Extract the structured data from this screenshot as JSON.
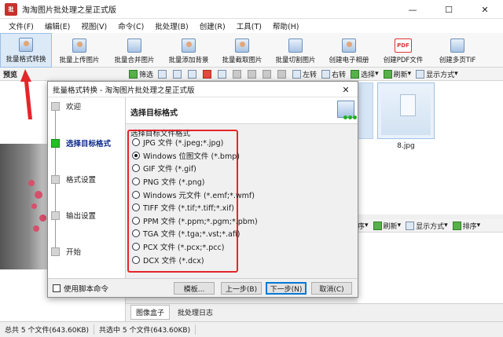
{
  "app": {
    "icon_text": "批",
    "title": "淘淘图片批处理之星正式版"
  },
  "window_controls": {
    "minimize": "—",
    "maximize": "☐",
    "close": "✕"
  },
  "menu": [
    "文件(F)",
    "编辑(E)",
    "视图(V)",
    "命令(C)",
    "批处理(B)",
    "创建(R)",
    "工具(T)",
    "帮助(H)"
  ],
  "toolbar": [
    {
      "label": "批量格式转换",
      "icon": "format-convert-icon"
    },
    {
      "label": "批量上传图片",
      "icon": "upload-icon"
    },
    {
      "label": "批量合并图片",
      "icon": "merge-icon"
    },
    {
      "label": "批量添加背景",
      "icon": "background-icon"
    },
    {
      "label": "批量截取图片",
      "icon": "crop-icon"
    },
    {
      "label": "批量切割图片",
      "icon": "cut-icon"
    },
    {
      "label": "创建电子相册",
      "icon": "album-icon"
    },
    {
      "label": "创建PDF文件",
      "icon": "pdf-icon",
      "icon_text": "PDF"
    },
    {
      "label": "创建多页TIF",
      "icon": "tif-icon"
    }
  ],
  "subbar": {
    "preview": "预览",
    "filter": "筛选",
    "rotate_left": "左转",
    "rotate_right": "右转",
    "select": "选择",
    "refresh": "刷新",
    "display_mode": "显示方式"
  },
  "files": {
    "thumb_label": "8.jpg"
  },
  "right_bar2": {
    "sort_hint": "序",
    "refresh": "刷新",
    "display_mode": "显示方式",
    "sort": "排序"
  },
  "bottom_tabs": [
    "图像盒子",
    "批处理日志"
  ],
  "status": {
    "total": "总共 5 个文件(643.60KB)",
    "selected": "共选中 5 个文件(643.60KB)"
  },
  "dialog": {
    "title": "批量格式转换 - 淘淘图片批处理之星正式版",
    "close": "✕",
    "steps": [
      {
        "label": "欢迎",
        "active": false
      },
      {
        "label": "选择目标格式",
        "active": true
      },
      {
        "label": "格式设置",
        "active": false
      },
      {
        "label": "输出设置",
        "active": false
      },
      {
        "label": "开始",
        "active": false
      }
    ],
    "heading": "选择目标格式",
    "group_label": "选择目标文件格式",
    "formats": [
      {
        "label": "JPG 文件 (*.jpeg;*.jpg)",
        "selected": false
      },
      {
        "label": "Windows 位图文件 (*.bmp)",
        "selected": true
      },
      {
        "label": "GIF 文件 (*.gif)",
        "selected": false
      },
      {
        "label": "PNG 文件 (*.png)",
        "selected": false
      },
      {
        "label": "Windows 元文件 (*.emf;*.wmf)",
        "selected": false
      },
      {
        "label": "TIFF 文件 (*.tif;*.tiff;*.xif)",
        "selected": false
      },
      {
        "label": "PPM 文件 (*.ppm;*.pgm;*.pbm)",
        "selected": false
      },
      {
        "label": "TGA 文件 (*.tga;*.vst;*.afi)",
        "selected": false
      },
      {
        "label": "PCX 文件 (*.pcx;*.pcc)",
        "selected": false
      },
      {
        "label": "DCX 文件 (*.dcx)",
        "selected": false
      }
    ],
    "use_script": "使用脚本命令",
    "buttons": {
      "template": "模板...",
      "prev": "上一步(B)",
      "next": "下一步(N)",
      "cancel": "取消(C)"
    }
  },
  "colors": {
    "highlight_border": "#e3262a",
    "active_step": "#22c022",
    "arrow": "#e3262a"
  }
}
